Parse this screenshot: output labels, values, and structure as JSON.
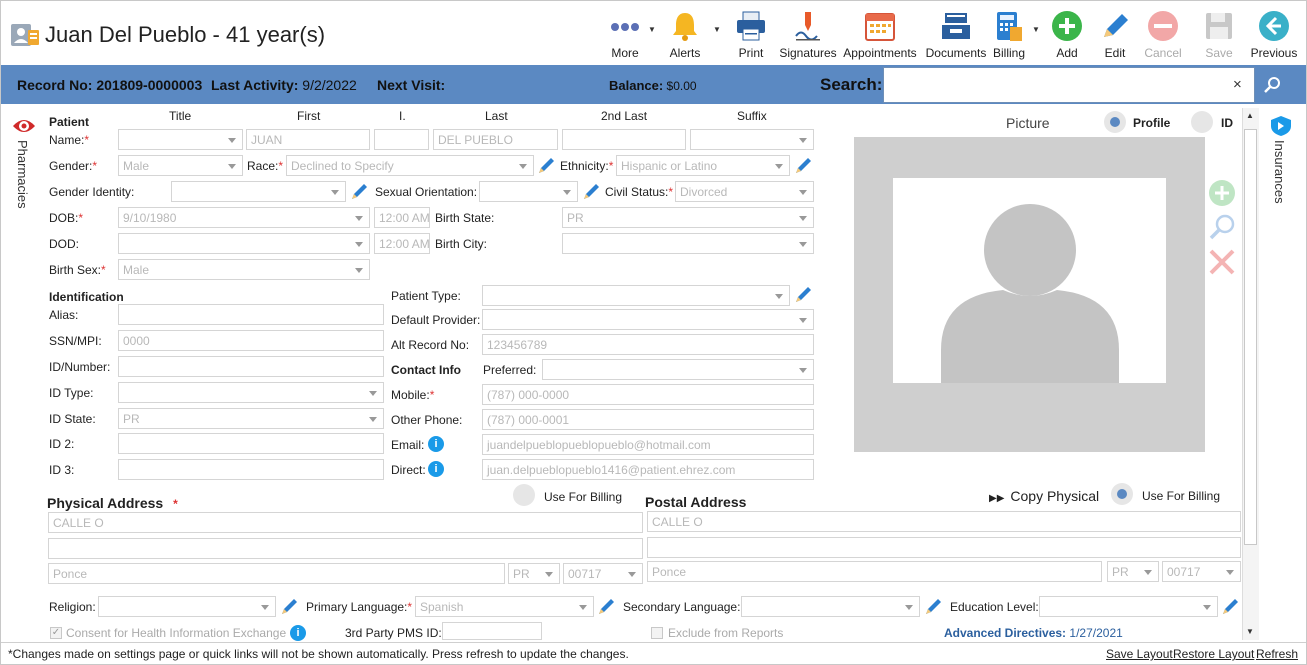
{
  "header": {
    "patient_title": "Juan Del Pueblo - 41 year(s)",
    "toolbar": [
      {
        "label": "More",
        "icon": "more-dots-icon"
      },
      {
        "label": "Alerts",
        "icon": "bell-icon"
      },
      {
        "label": "Print",
        "icon": "printer-icon"
      },
      {
        "label": "Signatures",
        "icon": "signature-pen-icon"
      },
      {
        "label": "Appointments",
        "icon": "calendar-icon"
      },
      {
        "label": "Documents",
        "icon": "documents-tray-icon"
      },
      {
        "label": "Billing",
        "icon": "billing-calculator-icon"
      },
      {
        "label": "Add",
        "icon": "plus-circle-icon"
      },
      {
        "label": "Edit",
        "icon": "pencil-icon"
      },
      {
        "label": "Cancel",
        "icon": "cancel-circle-icon"
      },
      {
        "label": "Save",
        "icon": "floppy-disk-icon"
      },
      {
        "label": "Previous",
        "icon": "arrow-left-circle-icon"
      }
    ]
  },
  "bar": {
    "record_label": "Record No:",
    "record_value": "201809-0000003",
    "activity_label": "Last Activity:",
    "activity_value": "9/2/2022",
    "next_label": "Next Visit:",
    "balance_label": "Balance:",
    "balance_value": "$0.00",
    "search_label": "Search:",
    "search_value": "",
    "clear_glyph": "×"
  },
  "side": {
    "left_tab": "Pharmacies",
    "right_tab": "Insurances"
  },
  "patient": {
    "section": "Patient",
    "col_title": "Title",
    "col_first": "First",
    "col_i": "I.",
    "col_last": "Last",
    "col_2nd_last": "2nd Last",
    "col_suffix": "Suffix",
    "name_label": "Name:",
    "first": "JUAN",
    "last": "DEL PUEBLO",
    "gender_label": "Gender:",
    "gender": "Male",
    "race_label": "Race:",
    "race": "Declined to Specify",
    "ethnicity_label": "Ethnicity:",
    "ethnicity": "Hispanic or Latino",
    "gender_identity_label": "Gender Identity:",
    "sexual_orientation_label": "Sexual Orientation:",
    "civil_status_label": "Civil Status:",
    "civil_status": "Divorced",
    "dob_label": "DOB:",
    "dob": "9/10/1980",
    "dob_time": "12:00 AM",
    "birth_state_label": "Birth State:",
    "birth_state": "PR",
    "dod_label": "DOD:",
    "dod_time": "12:00 AM",
    "birth_city_label": "Birth City:",
    "birth_sex_label": "Birth Sex:",
    "birth_sex": "Male"
  },
  "identification": {
    "section": "Identification",
    "alias_label": "Alias:",
    "ssn_label": "SSN/MPI:",
    "ssn": "0000",
    "idnum_label": "ID/Number:",
    "idtype_label": "ID Type:",
    "idstate_label": "ID State:",
    "idstate": "PR",
    "id2_label": "ID 2:",
    "id3_label": "ID 3:",
    "patient_type_label": "Patient Type:",
    "default_provider_label": "Default Provider:",
    "alt_record_label": "Alt Record No:",
    "alt_record": "123456789"
  },
  "contact": {
    "section": "Contact Info",
    "preferred_label": "Preferred:",
    "mobile_label": "Mobile:",
    "mobile": "(787) 000-0000",
    "other_phone_label": "Other Phone:",
    "other_phone": "(787) 000-0001",
    "email_label": "Email:",
    "email": "juandelpueblopueblopueblo@hotmail.com",
    "direct_label": "Direct:",
    "direct": "juan.delpueblopueblo1416@patient.ehrez.com",
    "info_glyph": "i"
  },
  "picture": {
    "label": "Picture",
    "profile_label": "Profile",
    "id_label": "ID"
  },
  "physical": {
    "title": "Physical Address",
    "req": "*",
    "use_billing": "Use For Billing",
    "line1": "CALLE O",
    "line2": "",
    "city": "Ponce",
    "state": "PR",
    "zip": "00717"
  },
  "postal": {
    "copy_label": "Copy Physical",
    "copy_glyph": "▶▶",
    "title": "Postal Address",
    "use_billing": "Use For Billing",
    "line1": "CALLE O",
    "line2": "",
    "city": "Ponce",
    "state": "PR",
    "zip": "00717"
  },
  "bottom": {
    "religion_label": "Religion:",
    "primary_lang_label": "Primary Language:",
    "primary_lang": "Spanish",
    "secondary_lang_label": "Secondary Language:",
    "education_label": "Education Level:",
    "consent_label": "Consent for Health Information Exchange",
    "pms_label": "3rd Party PMS ID:",
    "exclude_label": "Exclude from Reports",
    "adv_label": "Advanced Directives:",
    "adv_value": "1/27/2021",
    "check_glyph": "✓"
  },
  "footer": {
    "note": "*Changes made on settings page or quick links will not be shown automatically. Press refresh to update the changes.",
    "save_layout": "Save Layout",
    "restore_layout": "Restore Layout",
    "refresh": "Refresh"
  },
  "colors": {
    "bar": "#5b89c2",
    "add_green": "#3bb54a",
    "info_blue": "#1a9ae8",
    "cancel_red": "#e05a5a"
  }
}
